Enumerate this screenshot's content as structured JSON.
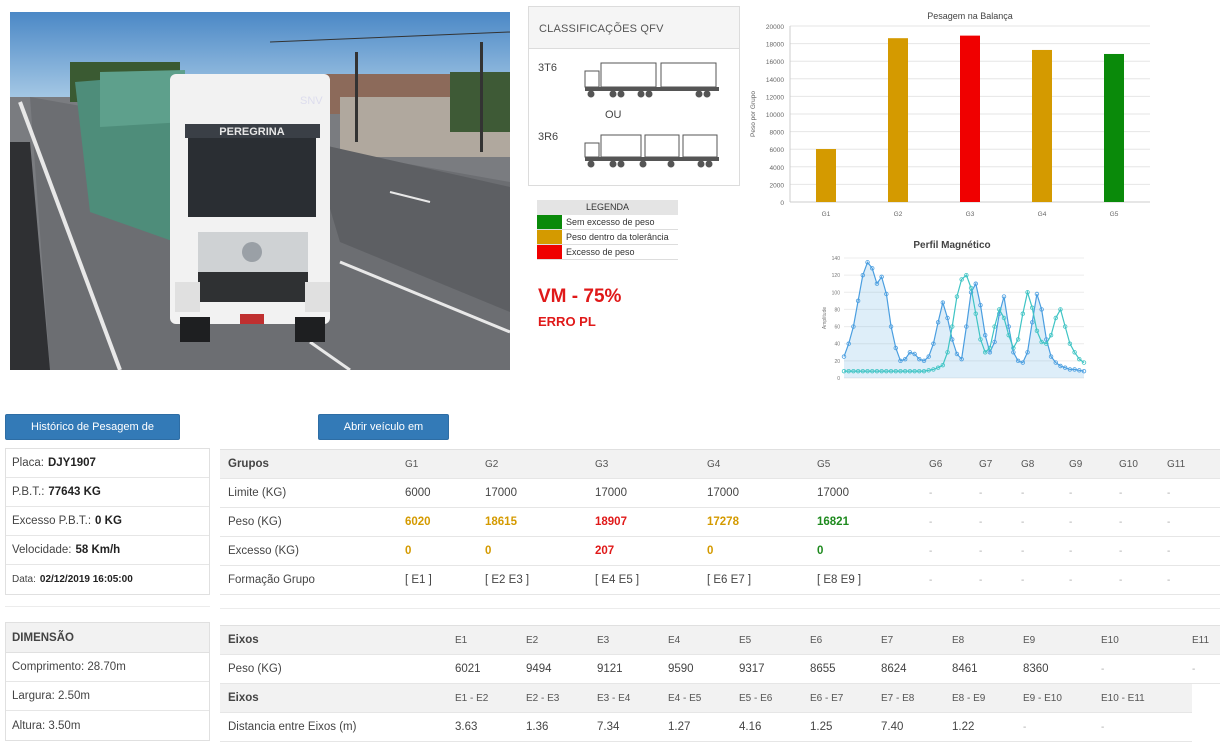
{
  "colors": {
    "green": "#0a8a0a",
    "orange": "#d49a00",
    "red": "#f00000",
    "button": "#337ab7",
    "alert_red": "#e01919"
  },
  "photo": {
    "truck_brand_text": "PEREGRINA",
    "sign_text": "SNV"
  },
  "qfv": {
    "title": "CLASSIFICAÇÕES QFV",
    "option1_code": "3T6",
    "or_label": "OU",
    "option2_code": "3R6",
    "truck1_icon": "truck-3t6-icon",
    "truck2_icon": "truck-3r6-icon"
  },
  "legend": {
    "title": "LEGENDA",
    "items": [
      {
        "label": "Sem excesso de peso",
        "color": "#0a8a0a"
      },
      {
        "label": "Peso dentro da tolerância",
        "color": "#d49a00"
      },
      {
        "label": "Excesso de peso",
        "color": "#f00000"
      }
    ]
  },
  "alert": {
    "vm": "VM - 75%",
    "erro": "ERRO PL"
  },
  "chart_data": [
    {
      "type": "bar",
      "title": "Pesagem na Balança",
      "ylabel": "Peso por Grupo",
      "xlabel": "",
      "ylim": [
        0,
        20000
      ],
      "yticks": [
        0,
        2000,
        4000,
        6000,
        8000,
        10000,
        12000,
        14000,
        16000,
        18000,
        20000
      ],
      "categories": [
        "G1",
        "G2",
        "G3",
        "G4",
        "G5"
      ],
      "values": [
        6020,
        18615,
        18907,
        17278,
        16821
      ],
      "colors": [
        "#d49a00",
        "#d49a00",
        "#f00000",
        "#d49a00",
        "#0a8a0a"
      ],
      "grid": true
    },
    {
      "type": "line",
      "title": "Perfil Magnético",
      "ylabel": "Amplitude",
      "ylim": [
        0,
        140
      ],
      "yticks": [
        0,
        20,
        40,
        60,
        80,
        100,
        120,
        140
      ],
      "grid": true,
      "series": [
        {
          "color": "#4a9ee0",
          "values": [
            25,
            40,
            60,
            90,
            120,
            135,
            128,
            110,
            118,
            98,
            60,
            35,
            20,
            22,
            30,
            28,
            22,
            20,
            25,
            40,
            65,
            88,
            70,
            45,
            28,
            22,
            60,
            100,
            110,
            85,
            50,
            30,
            42,
            75,
            95,
            60,
            30,
            20,
            18,
            30,
            65,
            98,
            80,
            45,
            25,
            18,
            14,
            12,
            10,
            10,
            9,
            8
          ]
        },
        {
          "color": "#3ec4c4",
          "values": [
            8,
            8,
            8,
            8,
            8,
            8,
            8,
            8,
            8,
            8,
            8,
            8,
            8,
            8,
            8,
            8,
            8,
            8,
            9,
            10,
            12,
            15,
            30,
            60,
            95,
            115,
            120,
            105,
            75,
            45,
            30,
            35,
            60,
            80,
            70,
            50,
            35,
            45,
            75,
            100,
            82,
            55,
            42,
            40,
            50,
            70,
            80,
            60,
            40,
            30,
            22,
            18
          ]
        }
      ]
    }
  ],
  "buttons": {
    "history": "Histórico de Pesagem de Veículos",
    "open_session": "Abrir veículo em sessão"
  },
  "vehicle": {
    "plate_label": "Placa:",
    "plate": "DJY1907",
    "pbt_label": "P.B.T.:",
    "pbt": "77643 KG",
    "excess_label": "Excesso P.B.T.:",
    "excess": "0 KG",
    "speed_label": "Velocidade:",
    "speed": "58 Km/h",
    "date_label": "Data:",
    "date": "02/12/2019 16:05:00"
  },
  "dimension": {
    "title": "DIMENSÃO",
    "length": "Comprimento: 28.70m",
    "width": "Largura: 2.50m",
    "height": "Altura: 3.50m"
  },
  "groups": {
    "header": "Grupos",
    "columns": [
      "G1",
      "G2",
      "G3",
      "G4",
      "G5",
      "G6",
      "G7",
      "G8",
      "G9",
      "G10",
      "G11"
    ],
    "limit_label": "Limite (KG)",
    "limit": [
      "6000",
      "17000",
      "17000",
      "17000",
      "17000",
      "-",
      "-",
      "-",
      "-",
      "-",
      "-"
    ],
    "weight_label": "Peso (KG)",
    "weight": [
      "6020",
      "18615",
      "18907",
      "17278",
      "16821",
      "-",
      "-",
      "-",
      "-",
      "-",
      "-"
    ],
    "weight_status": [
      "orange",
      "orange",
      "red",
      "orange",
      "green",
      "",
      "",
      "",
      "",
      "",
      ""
    ],
    "excess_label": "Excesso (KG)",
    "excess": [
      "0",
      "0",
      "207",
      "0",
      "0",
      "-",
      "-",
      "-",
      "-",
      "-",
      "-"
    ],
    "formation_label": "Formação Grupo",
    "formation": [
      "[ E1 ]",
      "[ E2 E3 ]",
      "[ E4 E5 ]",
      "[ E6 E7 ]",
      "[ E8 E9 ]",
      "-",
      "-",
      "-",
      "-",
      "-",
      "-"
    ]
  },
  "axles": {
    "header": "Eixos",
    "columns": [
      "E1",
      "E2",
      "E3",
      "E4",
      "E5",
      "E6",
      "E7",
      "E8",
      "E9",
      "E10",
      "E11"
    ],
    "weight_label": "Peso (KG)",
    "weight": [
      "6021",
      "9494",
      "9121",
      "9590",
      "9317",
      "8655",
      "8624",
      "8461",
      "8360",
      "-",
      "-"
    ],
    "header2": "Eixos",
    "pairs": [
      "E1 - E2",
      "E2 - E3",
      "E3 - E4",
      "E4 - E5",
      "E5 - E6",
      "E6 - E7",
      "E7 - E8",
      "E8 - E9",
      "E9 - E10",
      "E10 - E11"
    ],
    "distance_label": "Distancia entre Eixos (m)",
    "distance": [
      "3.63",
      "1.36",
      "7.34",
      "1.27",
      "4.16",
      "1.25",
      "7.40",
      "1.22",
      "-",
      "-"
    ]
  }
}
